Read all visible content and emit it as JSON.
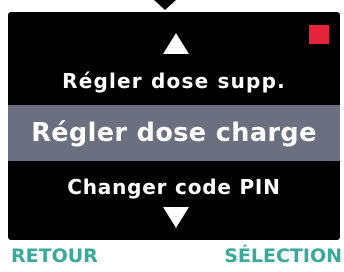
{
  "colors": {
    "screen_background": "#000000",
    "text": "#ffffff",
    "selected_row_background": "#6b6f80",
    "softkey_text": "#3aa89a",
    "indicator": "#e4243c"
  },
  "menu": {
    "scroll_up_icon": "triangle-up",
    "scroll_down_icon": "triangle-down",
    "items": [
      {
        "label": "Régler dose supp."
      },
      {
        "label": "Régler dose charge",
        "selected": true
      },
      {
        "label": "Changer code PIN"
      }
    ]
  },
  "softkeys": {
    "left_label": "RETOUR",
    "right_label": "SÉLECTION"
  },
  "status": {
    "indicator_icon": "red-square"
  }
}
